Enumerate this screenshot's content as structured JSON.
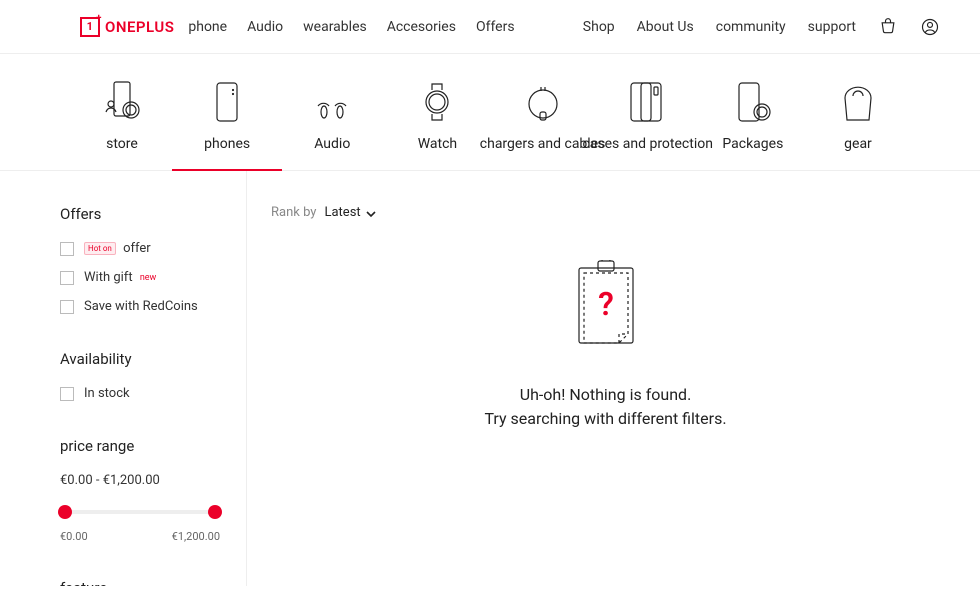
{
  "brand": "ONEPLUS",
  "nav_primary": [
    "phone",
    "Audio",
    "wearables",
    "Accesories",
    "Offers"
  ],
  "nav_secondary": [
    "Shop",
    "About Us",
    "community",
    "support"
  ],
  "categories": [
    {
      "label": "store"
    },
    {
      "label": "phones"
    },
    {
      "label": "Audio"
    },
    {
      "label": "Watch"
    },
    {
      "label": "chargers and cables"
    },
    {
      "label": "cases and protection"
    },
    {
      "label": "Packages"
    },
    {
      "label": "gear"
    }
  ],
  "sidebar": {
    "offers_title": "Offers",
    "offers_items": [
      {
        "tag_prefix": "Hot on",
        "label": "offer"
      },
      {
        "label": "With gift",
        "tag_suffix": "new"
      },
      {
        "label": "Save with RedCoins"
      }
    ],
    "availability_title": "Availability",
    "availability_items": [
      {
        "label": "In stock"
      }
    ],
    "price_title": "price range",
    "price_range": "€0.00 - €1,200.00",
    "price_min_label": "€0.00",
    "price_max_label": "€1,200.00",
    "feature_title": "feature"
  },
  "main": {
    "rank_label": "Rank by",
    "rank_value": "Latest",
    "empty_line1": "Uh-oh! Nothing is found.",
    "empty_line2": "Try searching with different filters."
  }
}
